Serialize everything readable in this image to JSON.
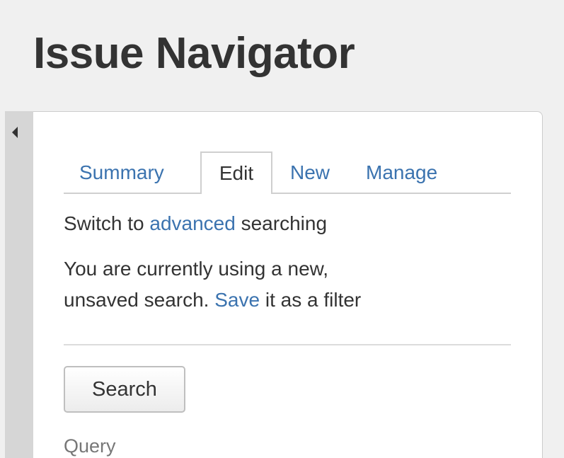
{
  "header": {
    "title": "Issue Navigator"
  },
  "sidebar_toggle": {
    "icon": "arrow-left-icon"
  },
  "tabs": [
    {
      "label": "Summary",
      "active": false
    },
    {
      "label": "Edit",
      "active": true
    },
    {
      "label": "New",
      "active": false
    },
    {
      "label": "Manage",
      "active": false
    }
  ],
  "switch_mode": {
    "prefix": "Switch to",
    "link": "advanced",
    "suffix": "searching"
  },
  "status": {
    "line1": "You are currently using a new,",
    "line2_prefix": "unsaved search.",
    "save_link": "Save",
    "line2_suffix": "it as a filter"
  },
  "search_button": {
    "label": "Search"
  },
  "query": {
    "label": "Query"
  },
  "colors": {
    "link": "#3b73af",
    "text": "#333333",
    "background": "#f0f0f0",
    "panel": "#ffffff",
    "muted": "#777777"
  }
}
